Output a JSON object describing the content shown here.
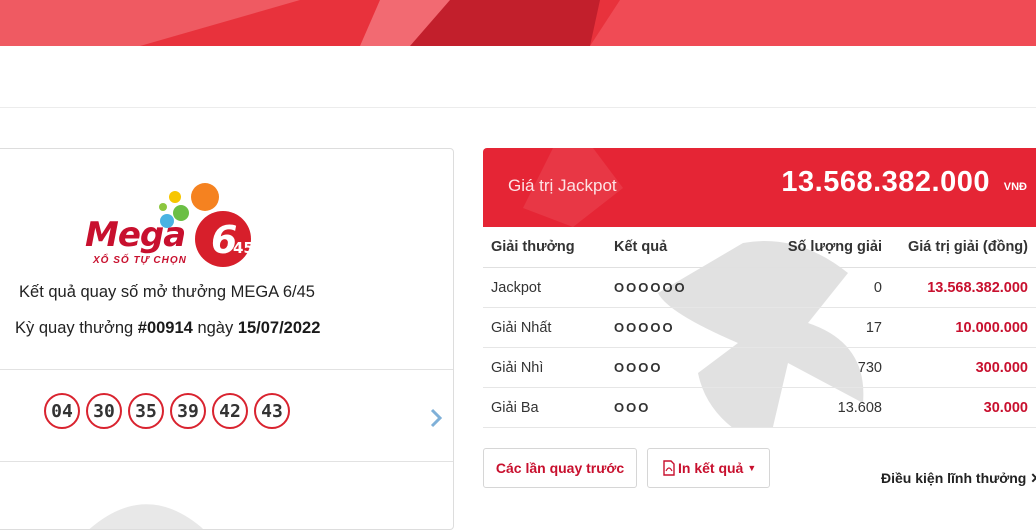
{
  "logo": {
    "brand": "Mega",
    "number_big": "6",
    "number_small": "45",
    "tagline": "XỔ SỐ TỰ CHỌN"
  },
  "result": {
    "title": "Kết quả quay số mở thưởng MEGA 6/45",
    "draw_prefix": "Kỳ quay thưởng",
    "draw_number": "#00914",
    "date_prefix": "ngày",
    "draw_date": "15/07/2022",
    "numbers": [
      "04",
      "30",
      "35",
      "39",
      "42",
      "43"
    ]
  },
  "jackpot": {
    "label": "Giá trị Jackpot",
    "value": "13.568.382.000",
    "unit": "VNĐ"
  },
  "prize_table": {
    "headers": [
      "Giải thưởng",
      "Kết quả",
      "Số lượng giải",
      "Giá trị giải (đồng)"
    ],
    "rows": [
      {
        "name": "Jackpot",
        "dots": "OOOOOO",
        "count": "0",
        "value": "13.568.382.000"
      },
      {
        "name": "Giải Nhất",
        "dots": "OOOOO",
        "count": "17",
        "value": "10.000.000"
      },
      {
        "name": "Giải Nhì",
        "dots": "OOOO",
        "count": "730",
        "value": "300.000"
      },
      {
        "name": "Giải Ba",
        "dots": "OOO",
        "count": "13.608",
        "value": "30.000"
      }
    ]
  },
  "actions": {
    "previous_draws": "Các lần quay trước",
    "print_results": "In kết quả",
    "prize_conditions": "Điều kiện lĩnh thưởng"
  },
  "colors": {
    "accent": "#e52535",
    "ball_border": "#d9232f",
    "value_red": "#c8102e"
  },
  "icons": [
    "chevron-right-icon",
    "pdf-icon",
    "caret-down-icon",
    "close-icon"
  ]
}
